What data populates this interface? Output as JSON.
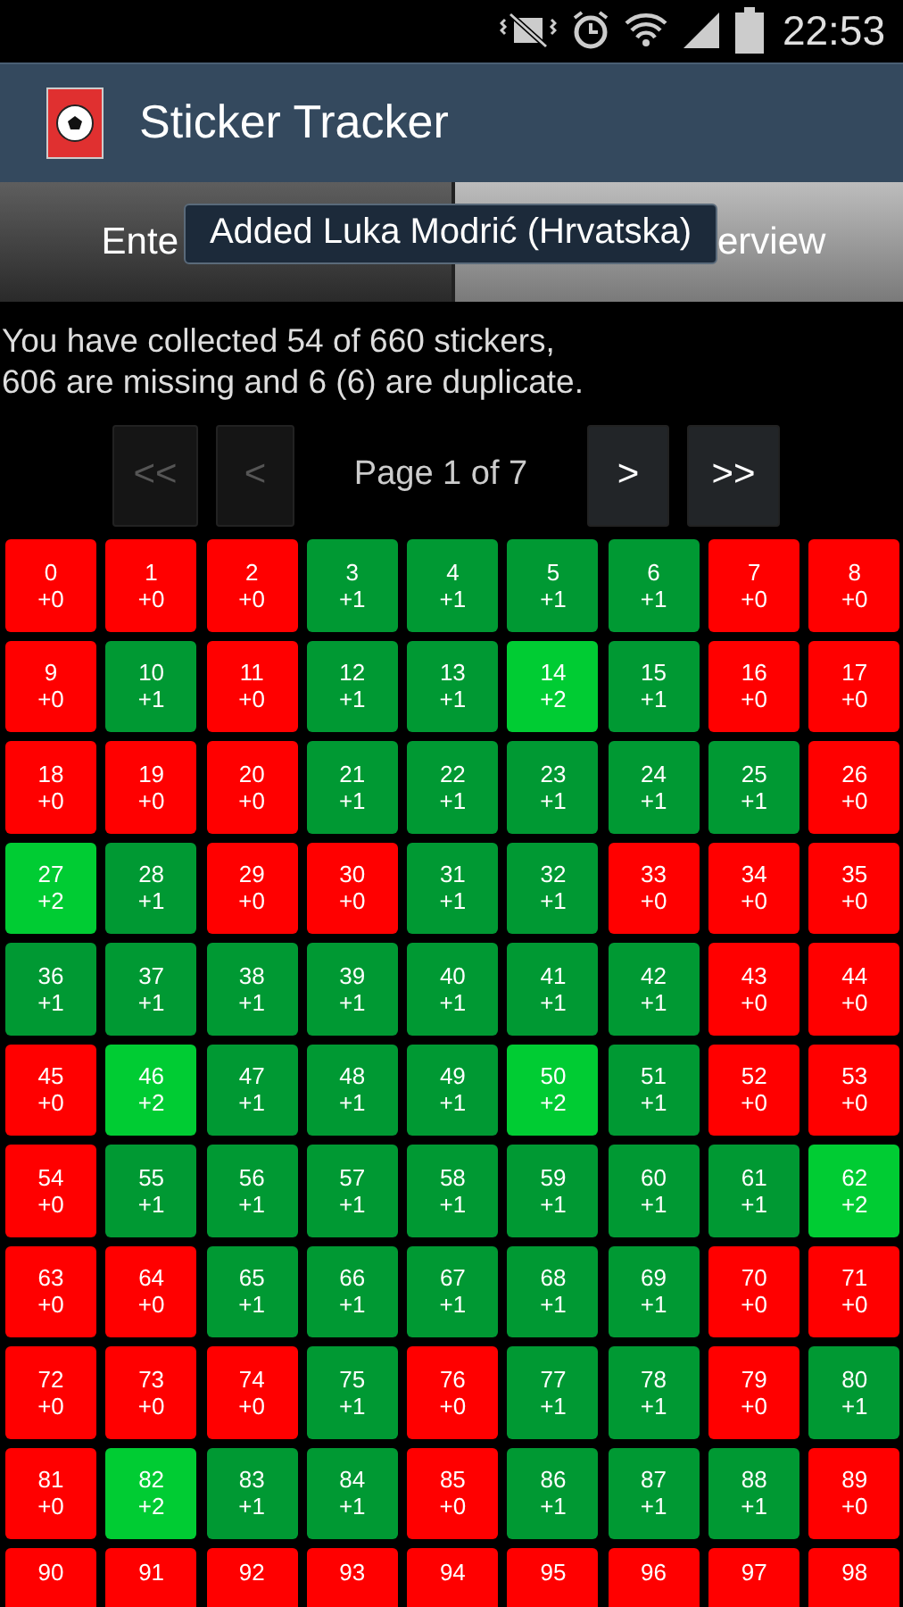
{
  "status_bar": {
    "time": "22:53"
  },
  "app_bar": {
    "title": "Sticker Tracker"
  },
  "tabs": [
    {
      "label": "Ente",
      "selected": false
    },
    {
      "label": "erview",
      "selected": true
    }
  ],
  "toast": "Added Luka Modrić (Hrvatska)",
  "summary": [
    "You have collected 54 of 660 stickers,",
    "606 are missing and 6 (6) are duplicate."
  ],
  "pager": {
    "buttons": [
      {
        "label": "<<",
        "disabled": true
      },
      {
        "label": "<",
        "disabled": true
      },
      {
        "label": ">",
        "disabled": false
      },
      {
        "label": ">>",
        "disabled": false
      }
    ],
    "page_label": "Page 1 of 7"
  },
  "stickers": [
    {
      "number": "0",
      "count": "+0",
      "kind": "missing"
    },
    {
      "number": "1",
      "count": "+0",
      "kind": "missing"
    },
    {
      "number": "2",
      "count": "+0",
      "kind": "missing"
    },
    {
      "number": "3",
      "count": "+1",
      "kind": "have"
    },
    {
      "number": "4",
      "count": "+1",
      "kind": "have"
    },
    {
      "number": "5",
      "count": "+1",
      "kind": "have"
    },
    {
      "number": "6",
      "count": "+1",
      "kind": "have"
    },
    {
      "number": "7",
      "count": "+0",
      "kind": "missing"
    },
    {
      "number": "8",
      "count": "+0",
      "kind": "missing"
    },
    {
      "number": "9",
      "count": "+0",
      "kind": "missing"
    },
    {
      "number": "10",
      "count": "+1",
      "kind": "have"
    },
    {
      "number": "11",
      "count": "+0",
      "kind": "missing"
    },
    {
      "number": "12",
      "count": "+1",
      "kind": "have"
    },
    {
      "number": "13",
      "count": "+1",
      "kind": "have"
    },
    {
      "number": "14",
      "count": "+2",
      "kind": "duplicate"
    },
    {
      "number": "15",
      "count": "+1",
      "kind": "have"
    },
    {
      "number": "16",
      "count": "+0",
      "kind": "missing"
    },
    {
      "number": "17",
      "count": "+0",
      "kind": "missing"
    },
    {
      "number": "18",
      "count": "+0",
      "kind": "missing"
    },
    {
      "number": "19",
      "count": "+0",
      "kind": "missing"
    },
    {
      "number": "20",
      "count": "+0",
      "kind": "missing"
    },
    {
      "number": "21",
      "count": "+1",
      "kind": "have"
    },
    {
      "number": "22",
      "count": "+1",
      "kind": "have"
    },
    {
      "number": "23",
      "count": "+1",
      "kind": "have"
    },
    {
      "number": "24",
      "count": "+1",
      "kind": "have"
    },
    {
      "number": "25",
      "count": "+1",
      "kind": "have"
    },
    {
      "number": "26",
      "count": "+0",
      "kind": "missing"
    },
    {
      "number": "27",
      "count": "+2",
      "kind": "duplicate"
    },
    {
      "number": "28",
      "count": "+1",
      "kind": "have"
    },
    {
      "number": "29",
      "count": "+0",
      "kind": "missing"
    },
    {
      "number": "30",
      "count": "+0",
      "kind": "missing"
    },
    {
      "number": "31",
      "count": "+1",
      "kind": "have"
    },
    {
      "number": "32",
      "count": "+1",
      "kind": "have"
    },
    {
      "number": "33",
      "count": "+0",
      "kind": "missing"
    },
    {
      "number": "34",
      "count": "+0",
      "kind": "missing"
    },
    {
      "number": "35",
      "count": "+0",
      "kind": "missing"
    },
    {
      "number": "36",
      "count": "+1",
      "kind": "have"
    },
    {
      "number": "37",
      "count": "+1",
      "kind": "have"
    },
    {
      "number": "38",
      "count": "+1",
      "kind": "have"
    },
    {
      "number": "39",
      "count": "+1",
      "kind": "have"
    },
    {
      "number": "40",
      "count": "+1",
      "kind": "have"
    },
    {
      "number": "41",
      "count": "+1",
      "kind": "have"
    },
    {
      "number": "42",
      "count": "+1",
      "kind": "have"
    },
    {
      "number": "43",
      "count": "+0",
      "kind": "missing"
    },
    {
      "number": "44",
      "count": "+0",
      "kind": "missing"
    },
    {
      "number": "45",
      "count": "+0",
      "kind": "missing"
    },
    {
      "number": "46",
      "count": "+2",
      "kind": "duplicate"
    },
    {
      "number": "47",
      "count": "+1",
      "kind": "have"
    },
    {
      "number": "48",
      "count": "+1",
      "kind": "have"
    },
    {
      "number": "49",
      "count": "+1",
      "kind": "have"
    },
    {
      "number": "50",
      "count": "+2",
      "kind": "duplicate"
    },
    {
      "number": "51",
      "count": "+1",
      "kind": "have"
    },
    {
      "number": "52",
      "count": "+0",
      "kind": "missing"
    },
    {
      "number": "53",
      "count": "+0",
      "kind": "missing"
    },
    {
      "number": "54",
      "count": "+0",
      "kind": "missing"
    },
    {
      "number": "55",
      "count": "+1",
      "kind": "have"
    },
    {
      "number": "56",
      "count": "+1",
      "kind": "have"
    },
    {
      "number": "57",
      "count": "+1",
      "kind": "have"
    },
    {
      "number": "58",
      "count": "+1",
      "kind": "have"
    },
    {
      "number": "59",
      "count": "+1",
      "kind": "have"
    },
    {
      "number": "60",
      "count": "+1",
      "kind": "have"
    },
    {
      "number": "61",
      "count": "+1",
      "kind": "have"
    },
    {
      "number": "62",
      "count": "+2",
      "kind": "duplicate"
    },
    {
      "number": "63",
      "count": "+0",
      "kind": "missing"
    },
    {
      "number": "64",
      "count": "+0",
      "kind": "missing"
    },
    {
      "number": "65",
      "count": "+1",
      "kind": "have"
    },
    {
      "number": "66",
      "count": "+1",
      "kind": "have"
    },
    {
      "number": "67",
      "count": "+1",
      "kind": "have"
    },
    {
      "number": "68",
      "count": "+1",
      "kind": "have"
    },
    {
      "number": "69",
      "count": "+1",
      "kind": "have"
    },
    {
      "number": "70",
      "count": "+0",
      "kind": "missing"
    },
    {
      "number": "71",
      "count": "+0",
      "kind": "missing"
    },
    {
      "number": "72",
      "count": "+0",
      "kind": "missing"
    },
    {
      "number": "73",
      "count": "+0",
      "kind": "missing"
    },
    {
      "number": "74",
      "count": "+0",
      "kind": "missing"
    },
    {
      "number": "75",
      "count": "+1",
      "kind": "have"
    },
    {
      "number": "76",
      "count": "+0",
      "kind": "missing"
    },
    {
      "number": "77",
      "count": "+1",
      "kind": "have"
    },
    {
      "number": "78",
      "count": "+1",
      "kind": "have"
    },
    {
      "number": "79",
      "count": "+0",
      "kind": "missing"
    },
    {
      "number": "80",
      "count": "+1",
      "kind": "have"
    },
    {
      "number": "81",
      "count": "+0",
      "kind": "missing"
    },
    {
      "number": "82",
      "count": "+2",
      "kind": "duplicate"
    },
    {
      "number": "83",
      "count": "+1",
      "kind": "have"
    },
    {
      "number": "84",
      "count": "+1",
      "kind": "have"
    },
    {
      "number": "85",
      "count": "+0",
      "kind": "missing"
    },
    {
      "number": "86",
      "count": "+1",
      "kind": "have"
    },
    {
      "number": "87",
      "count": "+1",
      "kind": "have"
    },
    {
      "number": "88",
      "count": "+1",
      "kind": "have"
    },
    {
      "number": "89",
      "count": "+0",
      "kind": "missing"
    },
    {
      "number": "90",
      "kind": "missing"
    },
    {
      "number": "91",
      "kind": "missing"
    },
    {
      "number": "92",
      "kind": "missing"
    },
    {
      "number": "93",
      "kind": "missing"
    },
    {
      "number": "94",
      "kind": "missing"
    },
    {
      "number": "95",
      "kind": "missing"
    },
    {
      "number": "96",
      "kind": "missing"
    },
    {
      "number": "97",
      "kind": "missing"
    },
    {
      "number": "98",
      "kind": "missing"
    }
  ]
}
